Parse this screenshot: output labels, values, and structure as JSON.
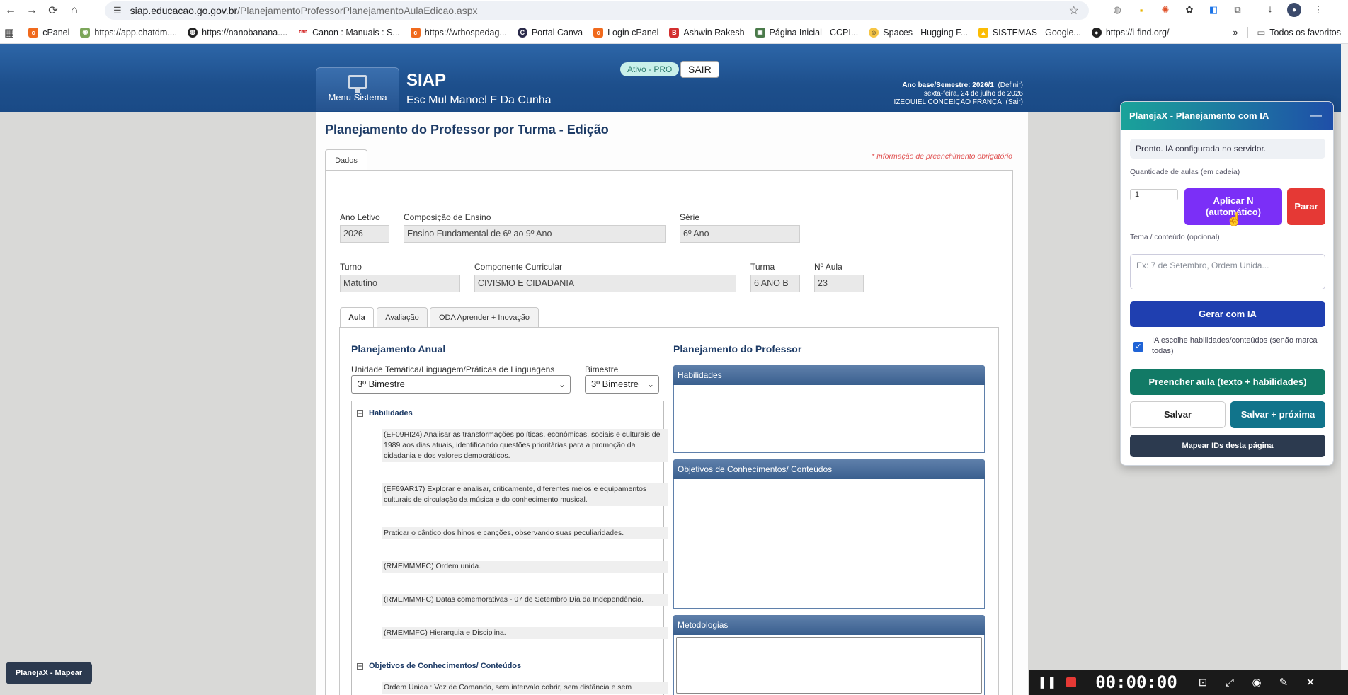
{
  "browser": {
    "url_host": "siap.educacao.go.gov.br",
    "url_path": "/PlanejamentoProfessorPlanejamentoAulaEdicao.aspx",
    "bookmarks": [
      "cPanel",
      "https://app.chatdm....",
      "https://nanobanana....",
      "Canon : Manuais : S...",
      "https://wrhospedag...",
      "Portal Canva",
      "Login cPanel",
      "Ashwin Rakesh",
      "Página Inicial - CCPI...",
      "Spaces - Hugging F...",
      "SISTEMAS - Google...",
      "https://i-find.org/"
    ],
    "all_bookmarks": "Todos os favoritos"
  },
  "header": {
    "menu_label": "Menu Sistema",
    "title": "SIAP",
    "school": "Esc Mul Manoel F Da Cunha",
    "status_pill": "Ativo - PRO",
    "sair": "SAIR",
    "ano_base": "Ano base/Semestre: 2026/1",
    "definir": "(Definir)",
    "date": "sexta-feira, 24 de julho de 2026",
    "user": "IZEQUIEL CONCEIÇÃO FRANÇA",
    "user_sair": "(Sair)"
  },
  "page": {
    "title": "Planejamento do Professor por Turma - Edição",
    "tab": "Dados",
    "required_note": "* Informação de preenchimento obrigatório"
  },
  "form": {
    "ano_letivo_label": "Ano Letivo",
    "ano_letivo": "2026",
    "composicao_label": "Composição de Ensino",
    "composicao": "Ensino Fundamental de 6º ao 9º Ano",
    "serie_label": "Série",
    "serie": "6º Ano",
    "turno_label": "Turno",
    "turno": "Matutino",
    "componente_label": "Componente Curricular",
    "componente": "CIVISMO E CIDADANIA",
    "turma_label": "Turma",
    "turma": "6 ANO B",
    "aula_label": "Nº Aula",
    "aula": "23"
  },
  "subtabs": [
    "Aula",
    "Avaliação",
    "ODA Aprender + Inovação"
  ],
  "anual": {
    "title": "Planejamento Anual",
    "unidade_label": "Unidade Temática/Linguagem/Práticas de Linguagens",
    "unidade_value": "3º Bimestre",
    "bimestre_label": "Bimestre",
    "bimestre_value": "3º Bimestre",
    "habilidades_head": "Habilidades",
    "habilidades": [
      "(EF09HI24) Analisar as transformações políticas, econômicas, sociais e culturais de 1989 aos dias atuais, identificando questões prioritárias para a promoção da cidadania e dos valores democráticos.",
      "(EF69AR17) Explorar e analisar, criticamente, diferentes meios e equipamentos culturais de circulação da música e do conhecimento musical.",
      "Praticar o cântico dos hinos e canções, observando suas peculiaridades.",
      "(RMEMMMFC) Ordem unida.",
      "(RMEMMMFC) Datas comemorativas - 07 de Setembro Dia da Independência.",
      "(RMEMMFC) Hierarquia e Disciplina."
    ],
    "objetivos_head": "Objetivos de Conhecimentos/ Conteúdos",
    "objetivo_first": "Ordem Unida : Voz de Comando, sem intervalo cobrir, sem distância e sem"
  },
  "professor": {
    "title": "Planejamento do Professor",
    "habilidades": "Habilidades",
    "objetivos": "Objetivos de Conhecimentos/ Conteúdos",
    "metodologias": "Metodologias"
  },
  "planejax": {
    "title": "PlanejaX - Planejamento com IA",
    "minimize": "—",
    "status": "Pronto. IA configurada no servidor.",
    "qtd_label": "Quantidade de aulas (em cadeia)",
    "qtd_value": "1",
    "aplicar": "Aplicar N (automático)",
    "parar": "Parar",
    "tema_label": "Tema / conteúdo (opcional)",
    "tema_placeholder": "Ex: 7 de Setembro, Ordem Unida...",
    "gerar": "Gerar com IA",
    "check_label": "IA escolhe habilidades/conteúdos (senão marca todas)",
    "preencher": "Preencher aula (texto + habilidades)",
    "salvar": "Salvar",
    "salvar_proxima": "Salvar + próxima",
    "mapear": "Mapear IDs desta página",
    "float_btn": "PlanejaX - Mapear"
  },
  "recorder": {
    "time": "00:00:00"
  },
  "colors": {
    "header": "#1d4f8c",
    "panel_head": "#3a5f8e",
    "aplicar": "#7b2ff7",
    "parar": "#e53935",
    "gerar": "#1f3fb0",
    "preencher": "#127a66",
    "salvar_proxima": "#11748b",
    "mapear": "#2c3a4f"
  }
}
